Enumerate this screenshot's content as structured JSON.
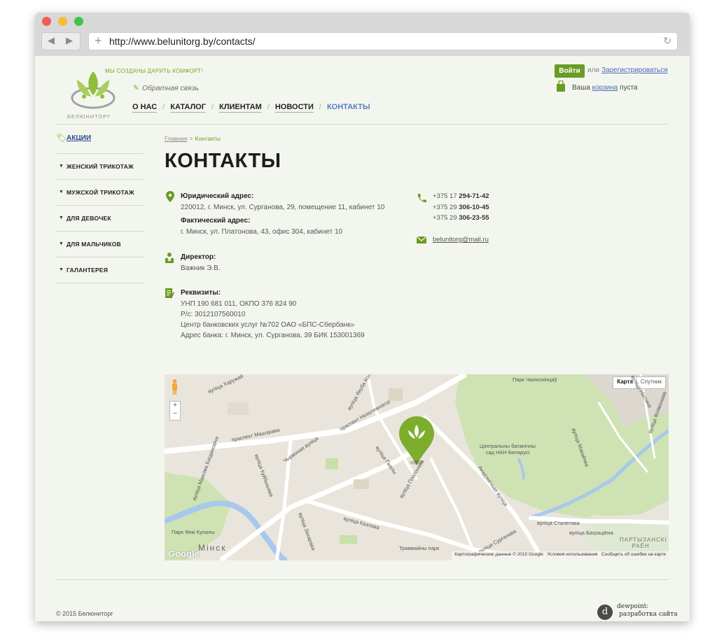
{
  "browser": {
    "url": "http://www.belunitorg.by/contacts/"
  },
  "header": {
    "slogan": "МЫ СОЗДАНЫ ДАРИТЬ КОМФОРТ!",
    "logo_text": "БЕЛЮНИТОРГ",
    "feedback": "Обратная связь",
    "nav": [
      "О НАС",
      "КАТАЛОГ",
      "КЛИЕНТАМ",
      "НОВОСТИ",
      "КОНТАКТЫ"
    ],
    "login_label": "Войти",
    "or_label": "или",
    "register_label": "Зарегистрироваться",
    "cart_prefix": "Ваша",
    "cart_link": "корзина",
    "cart_suffix": "пуста"
  },
  "sidebar": {
    "promo": "АКЦИИ",
    "items": [
      "ЖЕНСКИЙ ТРИКОТАЖ",
      "МУЖСКОЙ ТРИКОТАЖ",
      "ДЛЯ ДЕВОЧЕК",
      "ДЛЯ МАЛЬЧИКОВ",
      "ГАЛАНТЕРЕЯ"
    ]
  },
  "breadcrumb": {
    "home": "Главная",
    "separator": ">",
    "current": "Контакты"
  },
  "page_title": "КОНТАКТЫ",
  "contacts": {
    "legal_label": "Юридический адрес:",
    "legal_value": "220012, г. Минск, ул. Сурганова, 29, помещение 11, кабинет 10",
    "actual_label": "Фактический адрес:",
    "actual_value": "г. Минск, ул. Платонова, 43, офис 304, кабинет 10",
    "director_label": "Директор:",
    "director_value": "Важник Э.В.",
    "requisites_label": "Реквизиты:",
    "requisites": [
      "УНП 190 681 011, ОКПО 376 824 90",
      "Р/с: 3012107560010",
      "Центр банковских услуг №702 ОАО «БПС-Сбербанк»",
      "Адрес банка: г. Минск, ул. Сурганова, 39 БИК 153001369"
    ],
    "phones": [
      {
        "code": "+375 17",
        "number": "294-71-42"
      },
      {
        "code": "+375 29",
        "number": "306-10-45"
      },
      {
        "code": "+375 29",
        "number": "306-23-55"
      }
    ],
    "email": "belunitorg@mail.ru"
  },
  "map": {
    "type_map": "Карта",
    "type_satellite": "Спутник",
    "zoom_in": "+",
    "zoom_out": "−",
    "google": "Google",
    "footer_data": "Картографические данные © 2015 Google",
    "footer_terms": "Условия использования",
    "footer_report": "Сообщить об ошибке на карте",
    "labels": {
      "park_chelyuskintsev": "Парк Чалюскінцаў",
      "kharuzhai": "вуліца Харужай",
      "praspekt_mashera": "праспект Машэрава",
      "praspekt_nezalezhnasci": "праспект Незалежнасці",
      "chyrvonaya": "Чырвоная вуліца",
      "gikaly": "вуліца Гікалы",
      "platonava": "вуліца Платонава",
      "akademichnaya": "Акадэмічная вуліца",
      "botanical": "Цэнтральны батанічны сад НАН Беларусі",
      "stalyetava": "вуліца Сталетава",
      "kazlova": "вуліца Казлова",
      "park_kupaly": "Парк Янкі Купалы",
      "minsk": "Мінск",
      "partyzanski": "ПАРТЫЗАНСКІ РАЁН",
      "tramvaynyi": "Трамвайны парк",
      "surganava": "вуліца Сурганава",
      "bagrationa": "вуліца Баграціёна",
      "makayonka": "вуліца Макаёнка",
      "kuybysheva": "вуліца Куйбышава",
      "zakharava": "вуліца Захарава",
      "yakuba_kolasa": "вуліца Якуба Коласа",
      "maxima_bagdanovicha": "вуліца Максіма Багдановіча",
      "filimonava": "вуліца Філімонава",
      "nikitina": "вуліца Нікітина"
    }
  },
  "footer": {
    "copyright": "© 2015 Белюниторг",
    "dev_mark": "d",
    "dev_name": "dewpoint:",
    "dev_sub": "разработка сайта"
  }
}
